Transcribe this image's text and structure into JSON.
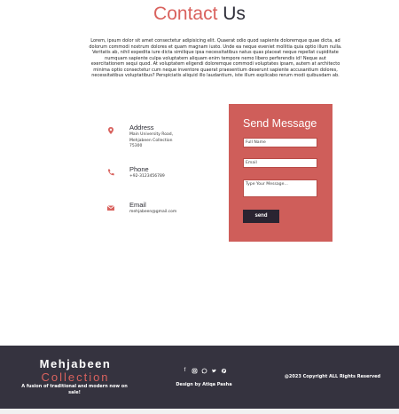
{
  "header": {
    "title_accent": "Contact",
    "title_rest": "Us"
  },
  "intro": {
    "text": "Lorem, ipsum dolor sit amet consectetur adipisicing elit. Quaerat odio quod sapiente doloremque quae dicta, ad dolorum commodi nostrum dolores et quam magnam iusto. Unde ea neque eveniet mollitia quia optio illum nulla. Veritatis ab, nihil expedita iure dicta similique ipsa necessitatibus natus quas placeat neque repellat cupiditate numquam sapiente culpa voluptatem aliquam enim tempore nemo libero perferendis id! Neque aut exercitationem sequi quod. At voluptatem eligendi doloremque commodi voluptates ipsam, autem at architecto minima optio consectetur cum neque inventore quaerat praesentium deserunt sapiente accusantium dolores, necessitatibus voluptatibus? Perspiciatis aliquid illo laudantium, iste illum explicabo rerum modi quibusdam ab."
  },
  "contact": {
    "address": {
      "title": "Address",
      "line1": "Main University Road,",
      "line2": "Mehjabeen Collection",
      "line3": "75300"
    },
    "phone": {
      "title": "Phone",
      "value": "+92-3123456789"
    },
    "email": {
      "title": "Email",
      "value": "mehjabeen@gmail.com"
    }
  },
  "form": {
    "title": "Send Message",
    "name_placeholder": "Full Name",
    "email_placeholder": "Email",
    "message_placeholder": "Type Your Message...",
    "submit_label": "send"
  },
  "footer": {
    "brand_line1": "Mehjabeen",
    "brand_line2": "Collection",
    "tagline": "A fusion of traditional and modern now on sale!",
    "social_icons": [
      "facebook-icon",
      "instagram-icon",
      "whatsapp-icon",
      "twitter-icon",
      "pinterest-icon"
    ],
    "designer": "Design by Atiqa Pasha",
    "copyright": "@2023 Copyright ALL Rights Reserved"
  },
  "colors": {
    "accent": "#d9625e",
    "form_background": "#cf5e5a",
    "footer_background": "#35333f",
    "button_background": "#2a2431"
  }
}
